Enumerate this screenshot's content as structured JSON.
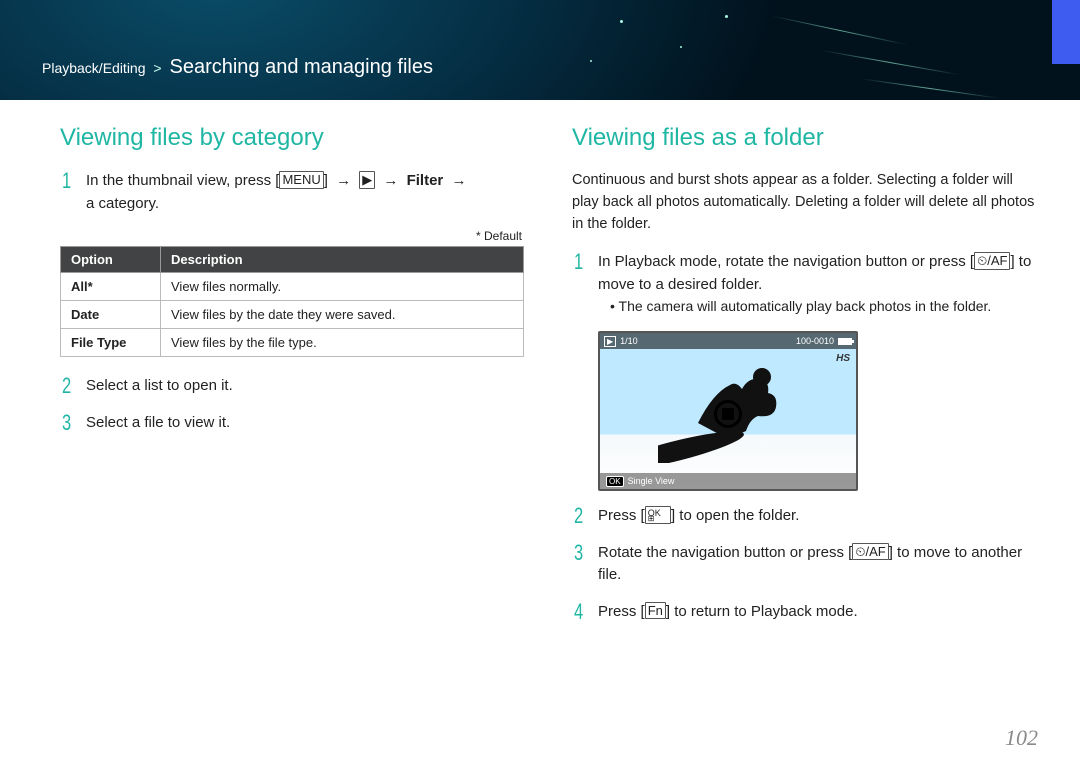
{
  "breadcrumb": {
    "category": "Playback/Editing",
    "sep": ">",
    "title": "Searching and managing files"
  },
  "page_number": "102",
  "left": {
    "heading": "Viewing files by category",
    "step1_a": "In the thumbnail view, press [",
    "menu_btn": "MENU",
    "arrow": "→",
    "play_btn": "▶",
    "filter_bold": "Filter",
    "step1_b": "a category.",
    "default_note": "* Default",
    "table": {
      "head_option": "Option",
      "head_desc": "Description",
      "rows": [
        {
          "opt": "All*",
          "desc": "View files normally."
        },
        {
          "opt": "Date",
          "desc": "View files by the date they were saved."
        },
        {
          "opt": "File Type",
          "desc": "View files by the file type."
        }
      ]
    },
    "step2": "Select a list to open it.",
    "step3": "Select a file to view it."
  },
  "right": {
    "heading": "Viewing files as a folder",
    "intro": "Continuous and burst shots appear as a folder. Selecting a folder will play back all photos automatically. Deleting a folder will delete all photos in the folder.",
    "step1_a": "In Playback mode, rotate the navigation button or press [",
    "nav_btn": "⏲/AF",
    "step1_b": "] to move to a desired folder.",
    "step1_sub": "The camera will automatically play back photos in the folder.",
    "shot": {
      "counter": "1/10",
      "fileno": "100-0010",
      "hs": "HS",
      "ok": "OK",
      "single": "Single View"
    },
    "step2_a": "Press [",
    "ok_btn": "OK",
    "step2_b": "] to open the folder.",
    "step3_a": "Rotate the navigation button or press [",
    "step3_b": "] to move to another file.",
    "step4_a": "Press [",
    "fn_btn": "Fn",
    "step4_b": "] to return to Playback mode."
  },
  "nums": {
    "n1": "1",
    "n2": "2",
    "n3": "3",
    "n4": "4"
  }
}
